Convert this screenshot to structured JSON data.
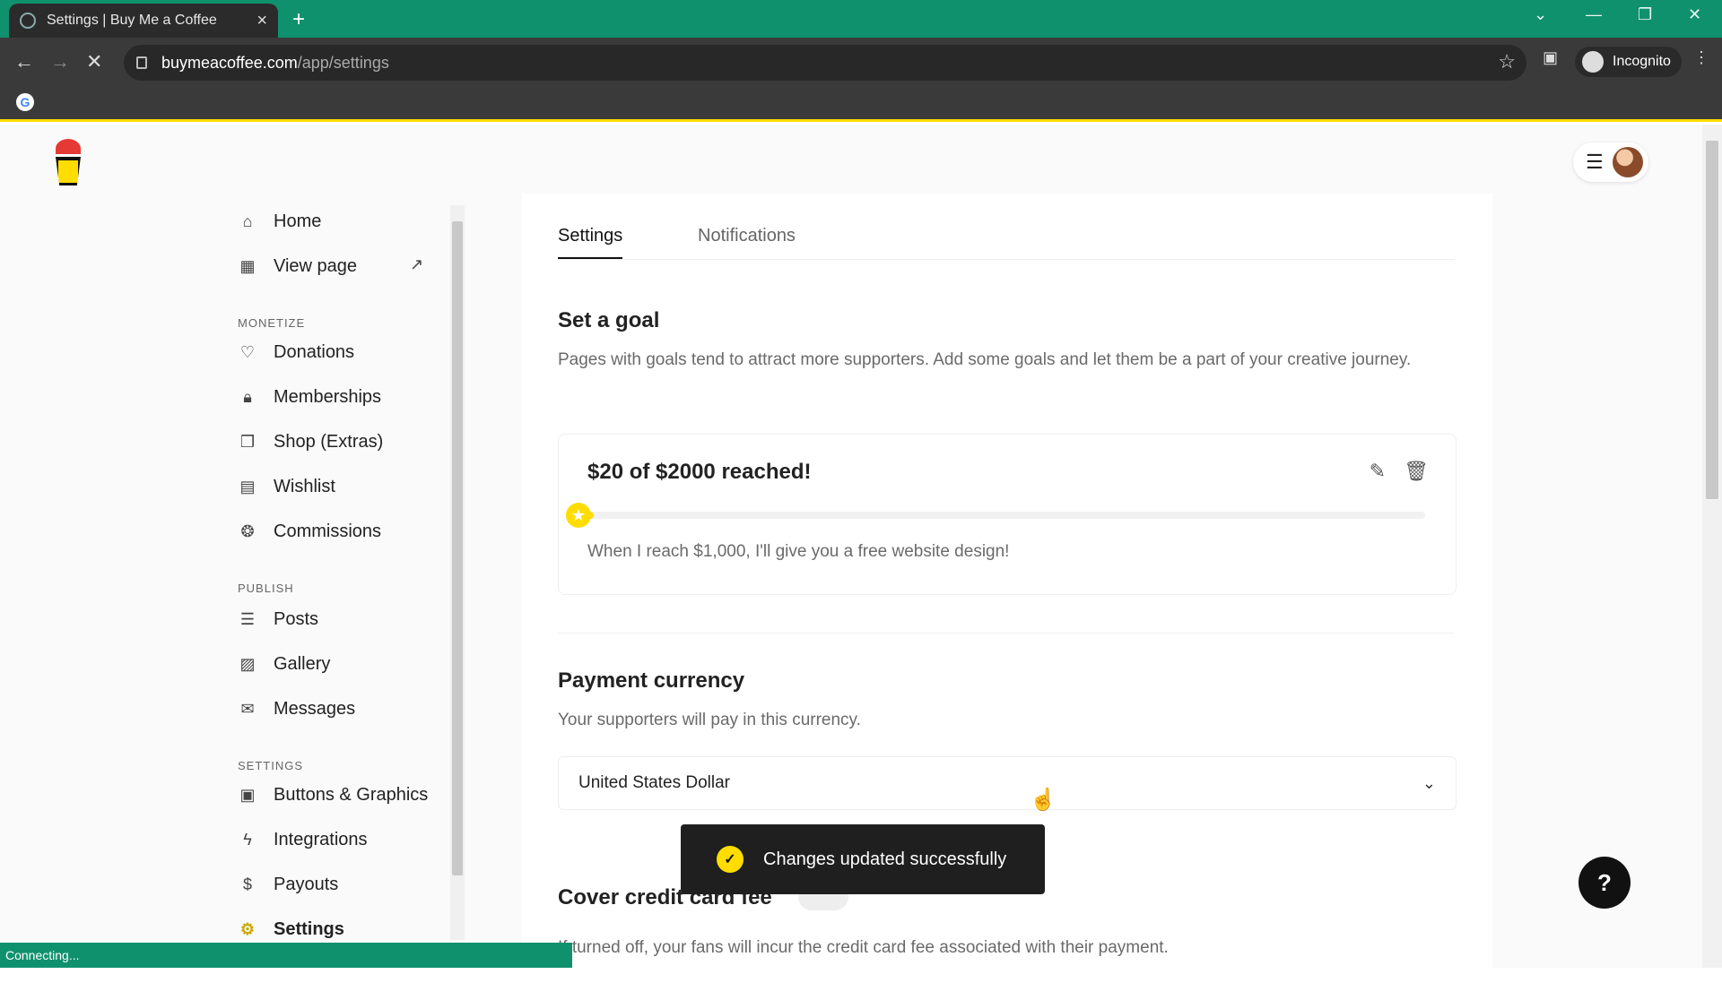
{
  "browser": {
    "tab_title": "Settings | Buy Me a Coffee",
    "url_domain": "buymeacoffee.com",
    "url_path": "/app/settings",
    "incognito_label": "Incognito",
    "status_text": "Connecting..."
  },
  "sidebar": {
    "top": [
      {
        "label": "Home",
        "icon": "home-icon"
      },
      {
        "label": "View page",
        "icon": "page-icon"
      }
    ],
    "monetize_title": "MONETIZE",
    "monetize": [
      {
        "label": "Donations",
        "icon": "heart-icon"
      },
      {
        "label": "Memberships",
        "icon": "lock-icon"
      },
      {
        "label": "Shop (Extras)",
        "icon": "gift-icon"
      },
      {
        "label": "Wishlist",
        "icon": "wishlist-icon"
      },
      {
        "label": "Commissions",
        "icon": "commission-icon"
      }
    ],
    "publish_title": "PUBLISH",
    "publish": [
      {
        "label": "Posts",
        "icon": "posts-icon"
      },
      {
        "label": "Gallery",
        "icon": "gallery-icon"
      },
      {
        "label": "Messages",
        "icon": "mail-icon"
      }
    ],
    "settings_title": "SETTINGS",
    "settings": [
      {
        "label": "Buttons & Graphics",
        "icon": "graphics-icon"
      },
      {
        "label": "Integrations",
        "icon": "bolt-icon"
      },
      {
        "label": "Payouts",
        "icon": "dollar-icon"
      },
      {
        "label": "Settings",
        "icon": "gear-icon"
      }
    ]
  },
  "main": {
    "tabs": [
      "Settings",
      "Notifications"
    ],
    "goal": {
      "heading": "Set a goal",
      "description": "Pages with goals tend to attract more supporters. Add some goals and let them be a part of your creative journey.",
      "title": "$20 of $2000 reached!",
      "progress_fraction": 0.01,
      "text": "When I reach $1,000, I'll give you a free website design!"
    },
    "currency": {
      "heading": "Payment currency",
      "description": "Your supporters will pay in this currency.",
      "selected": "United States Dollar"
    },
    "credit_fee": {
      "heading": "Cover credit card fee",
      "description": "If turned off, your fans will incur the credit card fee associated with their payment."
    }
  },
  "toast": {
    "message": "Changes updated successfully"
  },
  "help": {
    "label": "?"
  },
  "colors": {
    "brand_yellow": "#ffdd00",
    "browser_green": "#0f916e"
  }
}
